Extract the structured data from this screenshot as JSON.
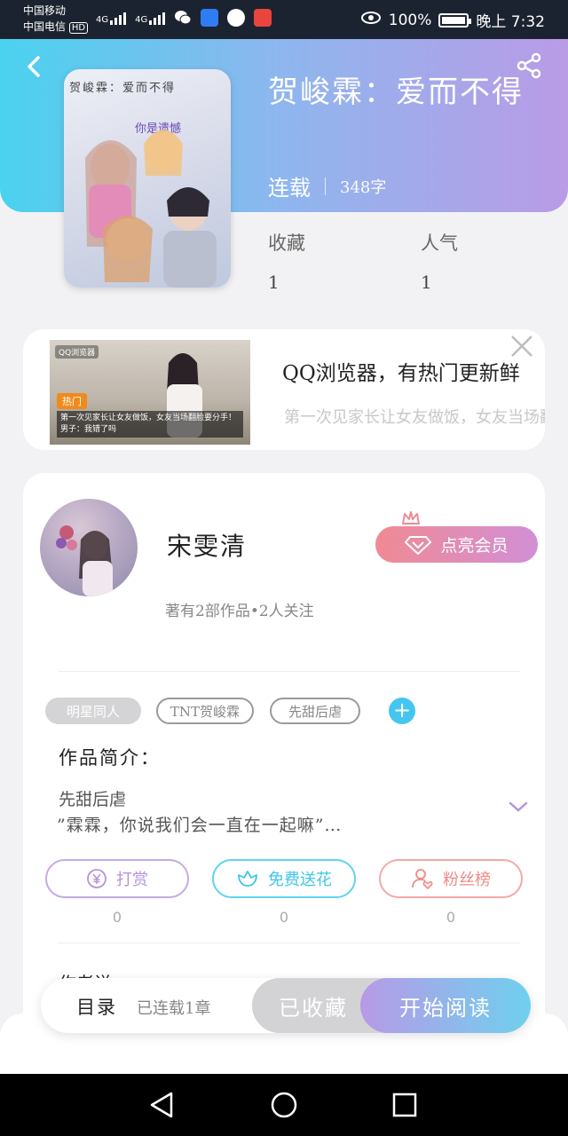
{
  "status_bar": {
    "carrier1": "中国移动",
    "carrier2": "中国电信",
    "hd": "HD",
    "net1": "4G",
    "net2": "4G",
    "battery_pct": "100%",
    "time": "晚上 7:32"
  },
  "book": {
    "title": "贺峻霖：爱而不得",
    "status": "连载",
    "words": "348字",
    "cover_title": "贺峻霖：爱而不得",
    "cover_sub": "你是遗憾",
    "stats": [
      {
        "label": "收藏",
        "value": "1"
      },
      {
        "label": "人气",
        "value": "1"
      }
    ]
  },
  "ad": {
    "title": "QQ浏览器，有热门更新鲜",
    "desc": "第一次见家长让女友做饭，女友当场翻脸要分手！男子：我",
    "img_tag": "QQ浏览器",
    "img_hot": "热门",
    "img_caption": "第一次见家长让女友做饭，女友当场翻脸要分手！男子：我错了吗"
  },
  "author": {
    "name": "宋雯清",
    "meta": "著有2部作品•2人关注",
    "vip_label": "点亮会员"
  },
  "tags": [
    "明星同人",
    "TNT贺峻霖",
    "先甜后虐"
  ],
  "intro": {
    "heading": "作品简介：",
    "line1": "先甜后虐",
    "line2": "”霖霖，你说我们会一直在一起嘛”…"
  },
  "actions": [
    {
      "label": "打赏",
      "count": "0"
    },
    {
      "label": "免费送花",
      "count": "0"
    },
    {
      "label": "粉丝榜",
      "count": "0"
    }
  ],
  "author_more": "作者说",
  "bottom": {
    "toc": "目录",
    "toc_sub": "已连载1章",
    "fav": "已收藏",
    "read": "开始阅读"
  },
  "colors": {
    "accent_blue": "#45c6ee",
    "accent_purple": "#b99be6",
    "vip_pink": "#f08a93"
  }
}
